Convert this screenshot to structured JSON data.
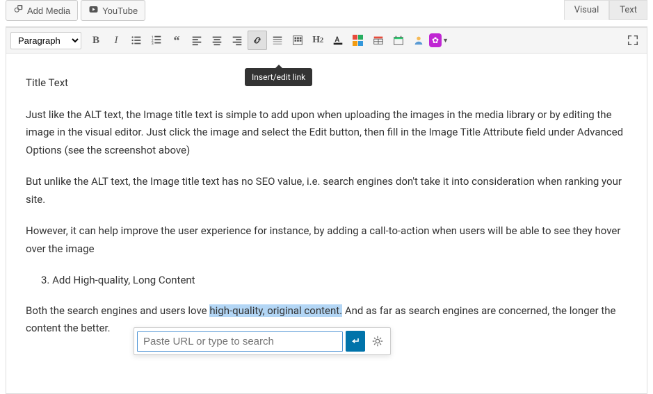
{
  "mediaButtons": {
    "addMedia": "Add Media",
    "youtube": "YouTube"
  },
  "tabs": {
    "visual": "Visual",
    "text": "Text"
  },
  "formatSelect": "Paragraph",
  "tooltip": "Insert/edit link",
  "h2Label": "H2",
  "content": {
    "title": "Title Text",
    "p1": "Just like the ALT text, the Image title text is simple to add upon when uploading the images in the media library or by editing the image in the visual editor. Just click the image and select the Edit button, then fill in the Image Title Attribute field under Advanced Options (see the screenshot above)",
    "p2": "But unlike the ALT text, the Image title text has no SEO value, i.e. search engines don't take it into consideration when ranking your site.",
    "p3": "However, it can help improve the user experience for instance, by adding a call-to-action when users will be able to see they hover over the image",
    "olNum": "3.",
    "olItem": "Add High-quality, Long Content",
    "p4a": "Both the search engines and users love ",
    "p4highlight": "high-quality, original content.",
    "p4b": " And as far as search engines are concerned, the longer the content the better."
  },
  "linkPopup": {
    "placeholder": "Paste URL or type to search"
  }
}
